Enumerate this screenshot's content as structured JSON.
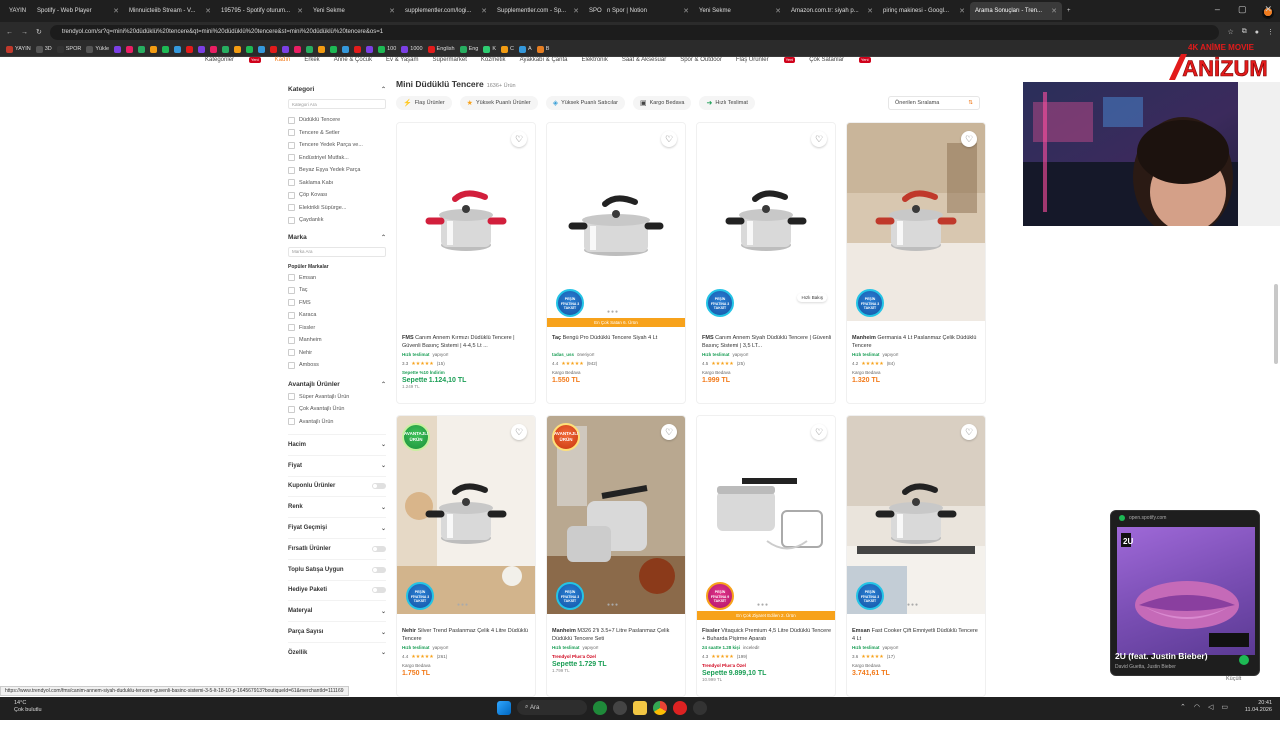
{
  "tabs": [
    {
      "label": "YAYIN",
      "color": "#c0392b"
    },
    {
      "label": "Spotify - Web Player",
      "color": "#1db954"
    },
    {
      "label": "Minnuicteiib Stream - V...",
      "color": "#1db954"
    },
    {
      "label": "195795 - Spotify oturum...",
      "color": "#e25c2b"
    },
    {
      "label": "Yeni Sekme",
      "color": "#888888"
    },
    {
      "label": "supplementler.com/logi...",
      "color": "#888888"
    },
    {
      "label": "Supplementler.com - Sp...",
      "color": "#888888"
    },
    {
      "label": "SPOR",
      "color": "#888888"
    },
    {
      "label": "n Spor | Notion",
      "color": "#888888"
    },
    {
      "label": "Yeni Sekme",
      "color": "#888888"
    },
    {
      "label": "Amazon.com.tr: siyah p...",
      "color": "#f59e1b"
    },
    {
      "label": "pirinç makinesi - Googl...",
      "color": "#4285f4"
    },
    {
      "label": "Arama Sonuçları - Tren...",
      "color": "#f27a1a"
    }
  ],
  "url": "trendyol.com/sr?q=mini%20düdüklü%20tencere&qt=mini%20düdüklü%20tencere&st=mini%20düdüklü%20tencere&os=1",
  "bookmarks": [
    "YAYIN",
    "3D",
    "SPOR",
    "Yükle",
    "100",
    "1000",
    "English",
    "Eng",
    "K",
    "C",
    "A",
    "B"
  ],
  "catnav": {
    "items": [
      "Kategoriler",
      "Kadın",
      "Erkek",
      "Anne & Çocuk",
      "Ev & Yaşam",
      "Süpermarket",
      "Kozmetik",
      "Ayakkabı & Çanta",
      "Elektronik",
      "Saat & Aksesuar",
      "Spor & Outdoor",
      "Flaş Ürünler",
      "Çok Satanlar"
    ],
    "new_label": "Yeni"
  },
  "sidebar": {
    "kategori_title": "Kategori",
    "kategori_search": "Kategori Ara",
    "categories": [
      "Düdüklü Tencere",
      "Tencere & Setler",
      "Tencere Yedek Parça ve...",
      "Endüstriyel Mutfak...",
      "Beyaz Eşya Yedek Parça",
      "Saklama Kabı",
      "Çöp Kovası",
      "Elektrikli Süpürge...",
      "Çaydanlık"
    ],
    "marka_title": "Marka",
    "marka_search": "Marka Ara",
    "popular_label": "Popüler Markalar",
    "brands": [
      "Emsan",
      "Taç",
      "FMS",
      "Karaca",
      "Fissler",
      "Manheim",
      "Nehir",
      "Amboss"
    ],
    "avantaj_title": "Avantajlı Ürünler",
    "avantaj": [
      "Süper Avantajlı Ürün",
      "Çok Avantajlı Ürün",
      "Avantajlı Ürün"
    ],
    "filters": [
      {
        "label": "Hacim",
        "type": "chevron"
      },
      {
        "label": "Fiyat",
        "type": "chevron"
      },
      {
        "label": "Kuponlu Ürünler",
        "type": "toggle"
      },
      {
        "label": "Renk",
        "type": "chevron"
      },
      {
        "label": "Fiyat Geçmişi",
        "type": "chevron"
      },
      {
        "label": "Fırsatlı Ürünler",
        "type": "toggle"
      },
      {
        "label": "Toplu Satışa Uygun",
        "type": "toggle"
      },
      {
        "label": "Hediye Paketi",
        "type": "toggle"
      },
      {
        "label": "Materyal",
        "type": "chevron"
      },
      {
        "label": "Parça Sayısı",
        "type": "chevron"
      },
      {
        "label": "Özellik",
        "type": "chevron"
      }
    ]
  },
  "main": {
    "title": "Mini Düdüklü Tencere",
    "count": "1636+ Ürün",
    "chips": [
      "Flaş Ürünler",
      "Yüksek Puanlı Ürünler",
      "Yüksek Puanlı Satıcılar",
      "Kargo Bedava",
      "Hızlı Teslimat"
    ],
    "sort": "Önerilen Sıralama"
  },
  "products": [
    {
      "brand": "FMS",
      "name": "Canım Annem Kırmızı Düdüklü Tencere | Güvenli Basınç Sistemi | 4-4,5 Lt ...",
      "fast": "Hızlı teslimat",
      "fast_suffix": "yapıyor!",
      "rating": "3.3",
      "reviews": "(15)",
      "extra": "Sepette %10 İndirim",
      "extra2": "Sepette",
      "price": "1.124,10 TL",
      "old": "1.249 TL",
      "kind": "red",
      "ribbon": "",
      "badge": "",
      "quick": ""
    },
    {
      "brand": "Taç",
      "name": "Bengü Pro Düdüklü Tencere Siyah 4 Lt",
      "fast": "tadas_uss",
      "fast_suffix": "öneriyor!",
      "rating": "4.4",
      "reviews": "(942)",
      "extra": "Kargo Bedava",
      "extra2": "",
      "price": "1.550 TL",
      "old": "",
      "kind": "big",
      "ribbon": "En Çok Satan 6. Ürün",
      "badge": "PEŞİN FİYATINA 3 TAKSİT",
      "quick": ""
    },
    {
      "brand": "FMS",
      "name": "Canım Annem Siyah Düdüklü Tencere | Güvenli Basınç Sistemi | 3,5 LT...",
      "fast": "Hızlı teslimat",
      "fast_suffix": "yapıyor!",
      "rating": "4.5",
      "reviews": "(25)",
      "extra": "Kargo Bedava",
      "extra2": "",
      "price": "1.999 TL",
      "old": "",
      "kind": "black",
      "ribbon": "",
      "badge": "PEŞİN FİYATINA 3 TAKSİT",
      "quick": "Hızlı Bakış"
    },
    {
      "brand": "Manheim",
      "name": "Germania 4 Lt Paslanmaz Çelik Düdüklü Tencere",
      "fast": "Hızlı teslimat",
      "fast_suffix": "yapıyor!",
      "rating": "4.2",
      "reviews": "(84)",
      "extra": "Kargo Bedava",
      "extra2": "",
      "price": "1.320 TL",
      "old": "",
      "kind": "kitchen",
      "ribbon": "",
      "badge": "PEŞİN FİYATINA 3 TAKSİT",
      "quick": ""
    },
    {
      "brand": "Nehir",
      "name": "Silver Trend Paslanmaz Çelik 4 Litre Düdüklü Tencere",
      "fast": "Hızlı teslimat",
      "fast_suffix": "yapıyor!",
      "rating": "4.4",
      "reviews": "(261)",
      "extra": "Kargo Bedava",
      "extra2": "",
      "price": "1.750 TL",
      "old": "",
      "kind": "shelf",
      "ribbon": "",
      "badge": "PEŞİN FİYATINA 3 TAKSİT",
      "quick": "",
      "top": "AVANTAJLI ÜRÜN",
      "top_kind": "green"
    },
    {
      "brand": "Manheim",
      "name": "M326 2'li 3.5+7 Litre Paslanmaz Çelik Düdüklü Tencere Seti",
      "fast": "Hızlı teslimat",
      "fast_suffix": "yapıyor!",
      "rating": "",
      "reviews": "",
      "extra": "Trendyol Plus'a Özel",
      "extra2": "Sepette",
      "price": "1.729 TL",
      "old": "1.799 TL",
      "kind": "set",
      "ribbon": "",
      "badge": "PEŞİN FİYATINA 3 TAKSİT",
      "quick": "",
      "top": "AVANTAJLI ÜRÜN",
      "top_kind": "orange"
    },
    {
      "brand": "Fissler",
      "name": "Vitaquick Premium 4,5 Litre Düdüklü Tencere + Buharda Pişirme Aparatı",
      "fast": "24 saatte 1.28 kişi",
      "fast_suffix": "inceledi!",
      "rating": "4.3",
      "reviews": "(199)",
      "extra": "Trendyol Plus'a Özel",
      "extra2": "Sepette",
      "price": "9.899,10 TL",
      "old": "10.999 TL",
      "kind": "fissler",
      "ribbon": "En Çok Ziyaret Edilen 2. Ürün",
      "badge": "PEŞİN FİYATINA 9 TAKSİT",
      "quick": ""
    },
    {
      "brand": "Emsan",
      "name": "Fast Cooker Çift Emniyetli Düdüklü Tencere 4 Lt",
      "fast": "Hızlı teslimat",
      "fast_suffix": "yapıyor!",
      "rating": "3.6",
      "reviews": "(17)",
      "extra": "Kargo Bedava",
      "extra2": "",
      "price": "3.741,61 TL",
      "old": "",
      "kind": "stove",
      "ribbon": "",
      "badge": "PEŞİN FİYATINA 3 TAKSİT",
      "quick": ""
    }
  ],
  "spotify": {
    "source": "open.spotify.com",
    "song": "2U (feat. Justin Bieber)",
    "artist": "David Guetta, Justin Bieber",
    "collapse": "Küçült"
  },
  "logo_text": "ANİZUM",
  "logo_sub": "4K ANİME MOVIE",
  "status_url": "https://www.trendyol.com/fms/canim-annem-siyah-duduklu-tencere-guvenli-basinc-sistemi-3-5-lt-18-10-p-164567913?boutiqueId=61&merchantId=111169",
  "taskbar": {
    "temp": "14°C",
    "weather": "Çok bulutlu",
    "search": "Ara",
    "time": "20:41",
    "date": "11.04.2026"
  }
}
